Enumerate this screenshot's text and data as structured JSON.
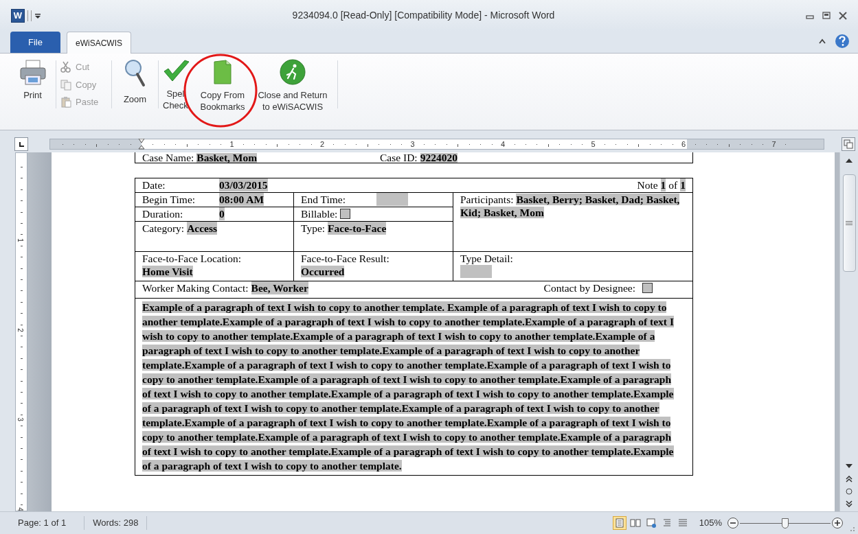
{
  "window": {
    "app_icon": "W",
    "title": "9234094.0 [Read-Only] [Compatibility Mode]  -  Microsoft Word"
  },
  "tabs": [
    {
      "label": "File",
      "selected": false,
      "kind": "file"
    },
    {
      "label": "eWiSACWIS",
      "selected": true,
      "kind": "tab"
    }
  ],
  "ribbon": {
    "print": {
      "label": "Print"
    },
    "clipboard": [
      {
        "label": "Cut",
        "disabled": true
      },
      {
        "label": "Copy",
        "disabled": true
      },
      {
        "label": "Paste",
        "disabled": true
      }
    ],
    "zoom": {
      "label": "Zoom"
    },
    "spell": {
      "lines": [
        "Spel",
        "Check"
      ]
    },
    "copy_from_bookmarks": {
      "lines": [
        "Copy From",
        "Bookmarks"
      ],
      "circled": true
    },
    "close_return": {
      "lines": [
        "Close and Return",
        "to eWiSACWIS"
      ]
    }
  },
  "ruler": {
    "labels": [
      "1",
      "2",
      "3",
      "4",
      "5",
      "6",
      "7"
    ]
  },
  "vertical_ruler": {
    "labels": [
      "1",
      "2",
      "3",
      "4"
    ]
  },
  "document": {
    "header": [
      {
        "label": "Case Name:",
        "value": "Basket, Mom"
      },
      {
        "label": "Case ID:",
        "value": "9224020"
      }
    ],
    "form": {
      "date_label": "Date:",
      "date": "03/03/2015",
      "note_label": "Note",
      "note_number": "1",
      "note_of": "of",
      "note_total": "1",
      "begin_time_label": "Begin Time:",
      "begin_time": "08:00 AM",
      "end_time_label": "End Time:",
      "participants_label": "Participants:",
      "participants": "Basket, Berry; Basket, Dad; Basket, Kid; Basket, Mom",
      "duration_label": "Duration:",
      "duration": "0",
      "billable_label": "Billable:",
      "billable_checked": false,
      "category_label": "Category:",
      "category": "Access",
      "type_label": "Type:",
      "type": "Face-to-Face",
      "location_label": "Face-to-Face Location:",
      "location": "Home Visit",
      "result_label": "Face-to-Face Result:",
      "result": "Occurred",
      "type_detail_label": "Type Detail:",
      "worker_label": "Worker Making Contact:",
      "worker": "Bee, Worker",
      "designee_label": "Contact by Designee:",
      "designee_checked": false
    },
    "paragraph": "Example of a paragraph of text I wish to copy to another template. Example of a paragraph of text I wish to copy to another template.Example of a paragraph of text I wish to copy to another template.Example of a paragraph of text I wish to copy to another template.Example of a paragraph of text I wish to copy to another template.Example of a paragraph of text I wish to copy to another template.Example of a paragraph of text I wish to copy to another template.Example of a paragraph of text I wish to copy to another template.Example of a paragraph of text I wish to copy to another template.Example of a paragraph of text I wish to copy to another template.Example of a paragraph of text I wish to copy to another template.Example of a paragraph of text I wish to copy to another template.Example of a paragraph of text I wish to copy to another template.Example of a paragraph of text I wish to copy to another template.Example of a paragraph of text I wish to copy to another template.Example of a paragraph of text I wish to copy to another template.Example of a paragraph of text I wish to copy to another template.Example of a paragraph of text I wish to copy to another template.Example of a paragraph of text I wish to copy to another template.Example of a paragraph of text I wish to copy to another template."
  },
  "status_bar": {
    "page": "Page: 1 of 1",
    "words": "Words: 298",
    "views": [
      {
        "selected": true
      },
      {
        "selected": false
      },
      {
        "selected": false
      },
      {
        "selected": false
      },
      {
        "selected": false
      }
    ],
    "zoom": "105%",
    "zoom_level": {
      "level": 0.5
    }
  }
}
